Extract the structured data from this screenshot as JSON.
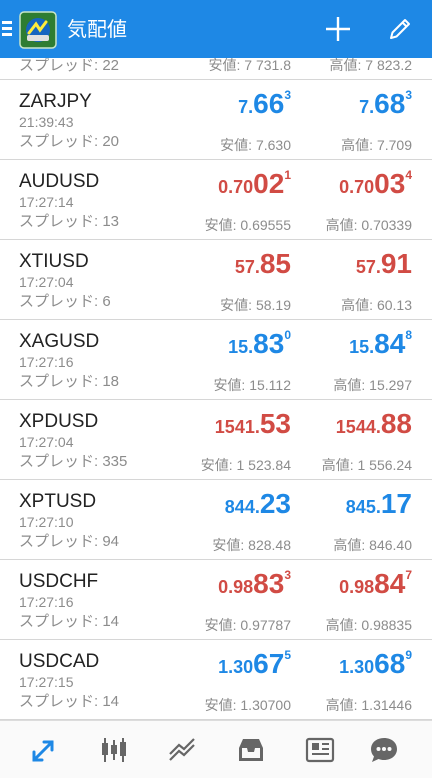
{
  "appbar": {
    "title": "気配値",
    "icons": [
      "menu-icon",
      "metatrader-logo",
      "plus-icon",
      "pencil-icon"
    ]
  },
  "partial_row": {
    "spread": "スプレッド: 22",
    "low": "安値: 7 731.8",
    "high": "高値: 7 823.2"
  },
  "quotes": [
    {
      "symbol": "ZARJPY",
      "time": "21:39:43",
      "spread": "スプレッド: 20",
      "bid": {
        "small": "7.",
        "big": "66",
        "sup": "3",
        "color": "#1e88e5"
      },
      "ask": {
        "small": "7.",
        "big": "68",
        "sup": "3",
        "color": "#1e88e5"
      },
      "low": "安値: 7.630",
      "high": "高値: 7.709"
    },
    {
      "symbol": "AUDUSD",
      "time": "17:27:14",
      "spread": "スプレッド: 13",
      "bid": {
        "small": "0.70",
        "big": "02",
        "sup": "1",
        "color": "#d14b44"
      },
      "ask": {
        "small": "0.70",
        "big": "03",
        "sup": "4",
        "color": "#d14b44"
      },
      "low": "安値: 0.69555",
      "high": "高値: 0.70339"
    },
    {
      "symbol": "XTIUSD",
      "time": "17:27:04",
      "spread": "スプレッド: 6",
      "bid": {
        "small": "57.",
        "big": "85",
        "sup": "",
        "color": "#d14b44"
      },
      "ask": {
        "small": "57.",
        "big": "91",
        "sup": "",
        "color": "#d14b44"
      },
      "low": "安値: 58.19",
      "high": "高値: 60.13"
    },
    {
      "symbol": "XAGUSD",
      "time": "17:27:16",
      "spread": "スプレッド: 18",
      "bid": {
        "small": "15.",
        "big": "83",
        "sup": "0",
        "color": "#1e88e5"
      },
      "ask": {
        "small": "15.",
        "big": "84",
        "sup": "8",
        "color": "#1e88e5"
      },
      "low": "安値: 15.112",
      "high": "高値: 15.297"
    },
    {
      "symbol": "XPDUSD",
      "time": "17:27:04",
      "spread": "スプレッド: 335",
      "bid": {
        "small": "1541.",
        "big": "53",
        "sup": "",
        "color": "#d14b44"
      },
      "ask": {
        "small": "1544.",
        "big": "88",
        "sup": "",
        "color": "#d14b44"
      },
      "low": "安値: 1 523.84",
      "high": "高値: 1 556.24"
    },
    {
      "symbol": "XPTUSD",
      "time": "17:27:10",
      "spread": "スプレッド: 94",
      "bid": {
        "small": "844.",
        "big": "23",
        "sup": "",
        "color": "#1e88e5"
      },
      "ask": {
        "small": "845.",
        "big": "17",
        "sup": "",
        "color": "#1e88e5"
      },
      "low": "安値: 828.48",
      "high": "高値: 846.40"
    },
    {
      "symbol": "USDCHF",
      "time": "17:27:16",
      "spread": "スプレッド: 14",
      "bid": {
        "small": "0.98",
        "big": "83",
        "sup": "3",
        "color": "#d14b44"
      },
      "ask": {
        "small": "0.98",
        "big": "84",
        "sup": "7",
        "color": "#d14b44"
      },
      "low": "安値: 0.97787",
      "high": "高値: 0.98835"
    },
    {
      "symbol": "USDCAD",
      "time": "17:27:15",
      "spread": "スプレッド: 14",
      "bid": {
        "small": "1.30",
        "big": "67",
        "sup": "5",
        "color": "#1e88e5"
      },
      "ask": {
        "small": "1.30",
        "big": "68",
        "sup": "9",
        "color": "#1e88e5"
      },
      "low": "安値: 1.30700",
      "high": "高値: 1.31446"
    }
  ],
  "bottom_nav": {
    "items": [
      "quotes-icon",
      "chart-icon",
      "trade-icon",
      "history-icon",
      "news-icon",
      "chat-icon"
    ],
    "active_color": "#1e88e5",
    "inactive_color": "#666666"
  }
}
